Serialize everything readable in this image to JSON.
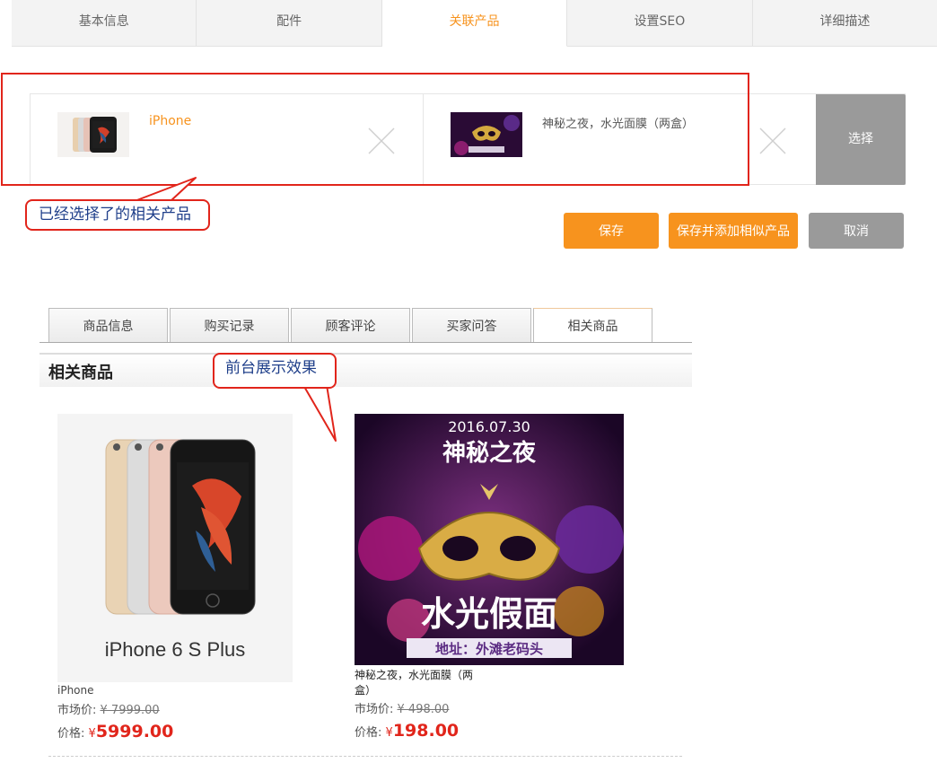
{
  "admin_tabs": [
    {
      "label": "基本信息",
      "active": false
    },
    {
      "label": "配件",
      "active": false
    },
    {
      "label": "关联产品",
      "active": true
    },
    {
      "label": "设置SEO",
      "active": false
    },
    {
      "label": "详细描述",
      "active": false
    }
  ],
  "selected_products": [
    {
      "name": "iPhone",
      "image": "iphone-thumbnail"
    },
    {
      "name": "神秘之夜，水光面膜（两盒）",
      "image": "mask-poster-thumbnail"
    }
  ],
  "choose_button": "选择",
  "annotations": {
    "selected_note": "已经选择了的相关产品",
    "frontend_note": "前台展示效果"
  },
  "actions": {
    "save": "保存",
    "save_and_add": "保存并添加相似产品",
    "cancel": "取消"
  },
  "frontend": {
    "tabs": [
      {
        "label": "商品信息",
        "active": false
      },
      {
        "label": "购买记录",
        "active": false
      },
      {
        "label": "顾客评论",
        "active": false
      },
      {
        "label": "买家问答",
        "active": false
      },
      {
        "label": "相关商品",
        "active": true
      }
    ],
    "section_title": "相关商品",
    "products": [
      {
        "name": "iPhone",
        "image_text": "iPhone 6 S Plus",
        "market_label": "市场价:",
        "market_price": "¥ 7999.00",
        "price_label": "价格:",
        "currency": "¥",
        "price": "5999.00"
      },
      {
        "name": "神秘之夜，水光面膜（两盒）",
        "image_texts": {
          "date": "2016.07.30",
          "title": "神秘之夜",
          "big": "水光假面",
          "address": "地址：外滩老码头"
        },
        "market_label": "市场价:",
        "market_price": "¥ 498.00",
        "price_label": "价格:",
        "currency": "¥",
        "price": "198.00"
      }
    ]
  },
  "colors": {
    "accent": "#f7931e",
    "annotation": "#e1251b",
    "annotation_text": "#1f3f8a",
    "price": "#e1251b",
    "gray_button": "#9a9a9a"
  }
}
